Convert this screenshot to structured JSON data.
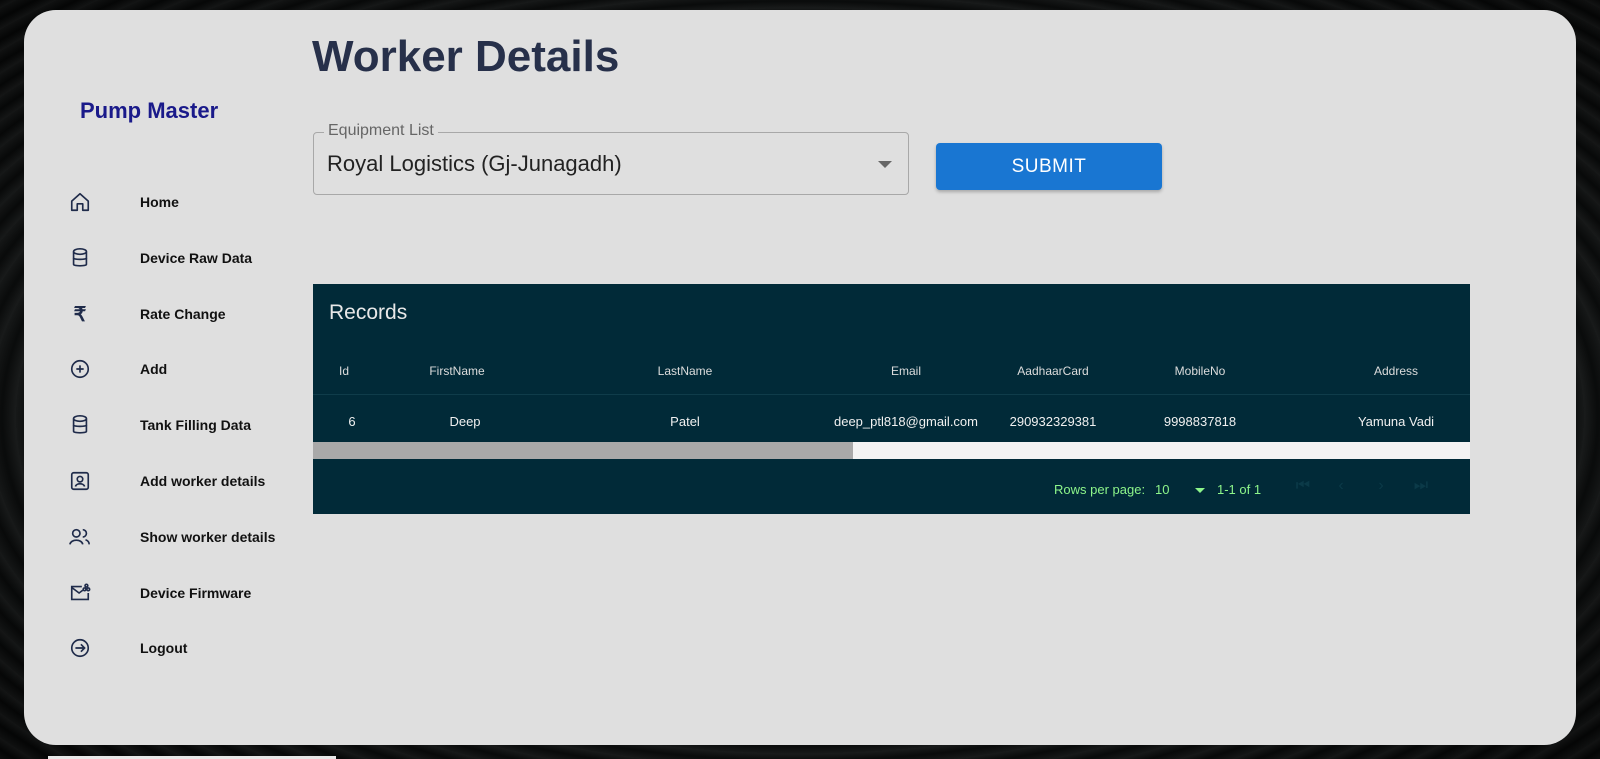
{
  "sidebar": {
    "brand": "Pump Master",
    "items": [
      {
        "label": "Home",
        "icon": "home-icon"
      },
      {
        "label": "Device Raw Data",
        "icon": "database-icon"
      },
      {
        "label": "Rate Change",
        "icon": "rupee-icon"
      },
      {
        "label": "Add",
        "icon": "add-circle-icon"
      },
      {
        "label": "Tank Filling Data",
        "icon": "database-icon"
      },
      {
        "label": "Add worker details",
        "icon": "contact-card-icon"
      },
      {
        "label": "Show worker details",
        "icon": "users-icon"
      },
      {
        "label": "Device Firmware",
        "icon": "mail-share-icon"
      },
      {
        "label": "Logout",
        "icon": "logout-icon"
      }
    ]
  },
  "main": {
    "title": "Worker Details",
    "equipment_select": {
      "label": "Equipment List",
      "value": "Royal Logistics (Gj-Junagadh)"
    },
    "submit_label": "SUBMIT"
  },
  "table": {
    "title": "Records",
    "columns": [
      "Id",
      "FirstName",
      "LastName",
      "Email",
      "AadhaarCard",
      "MobileNo",
      "Address"
    ],
    "rows": [
      [
        "6",
        "Deep",
        "Patel",
        "deep_ptl818@gmail.com",
        "290932329381",
        "9998837818",
        "Yamuna Vadi"
      ]
    ],
    "pagination": {
      "rows_per_page_label": "Rows per page:",
      "rows_per_page_value": "10",
      "range_label": "1-1 of 1"
    }
  },
  "colors": {
    "card_bg": "#dfdfdf",
    "table_bg": "#012a38",
    "brand": "#1a1a8a",
    "submit": "#1976d2",
    "pager_text": "#8df58a"
  }
}
